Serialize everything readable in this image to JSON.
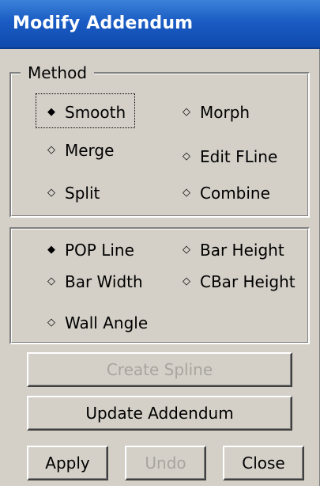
{
  "window": {
    "title": "Modify Addendum"
  },
  "method": {
    "legend": "Method",
    "options": [
      {
        "label": "Smooth",
        "selected": true
      },
      {
        "label": "Morph",
        "selected": false
      },
      {
        "label": "Merge",
        "selected": false
      },
      {
        "label": "Edit FLine",
        "selected": false
      },
      {
        "label": "Split",
        "selected": false
      },
      {
        "label": "Combine",
        "selected": false
      }
    ]
  },
  "parameters": {
    "options": [
      {
        "label": "POP Line",
        "selected": true
      },
      {
        "label": "Bar Height",
        "selected": false
      },
      {
        "label": "Bar Width",
        "selected": false
      },
      {
        "label": "CBar Height",
        "selected": false
      },
      {
        "label": "Wall Angle",
        "selected": false
      }
    ]
  },
  "buttons": {
    "create_spline": "Create Spline",
    "update_addendum": "Update Addendum",
    "apply": "Apply",
    "undo": "Undo",
    "close": "Close"
  },
  "glyphs": {
    "radio_on": "◆",
    "radio_off": "◇"
  }
}
